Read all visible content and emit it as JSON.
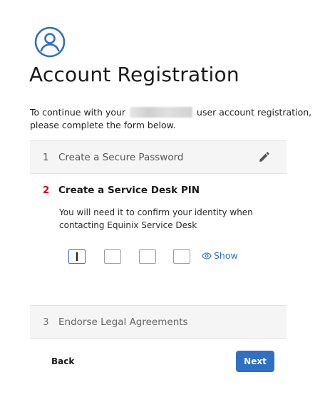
{
  "page": {
    "title": "Account Registration",
    "intro_before": "To continue with your",
    "intro_after": "user account registration,",
    "intro_line2": "please complete the form below."
  },
  "steps": [
    {
      "number": "1",
      "label": "Create a Secure Password",
      "icon": "pencil-icon"
    },
    {
      "number": "2",
      "label": "Create a Service Desk PIN",
      "help_line1": "You will need it to confirm your identity when",
      "help_line2": "contacting Equinix Service Desk"
    },
    {
      "number": "3",
      "label": "Endorse Legal Agreements"
    }
  ],
  "pin": {
    "show_label": "Show",
    "digits": [
      "",
      "",
      "",
      ""
    ]
  },
  "footer": {
    "back_label": "Back",
    "next_label": "Next"
  },
  "colors": {
    "accent": "#2f6fc4",
    "step_active_number": "#d0021b",
    "step_bg": "#f5f5f5"
  }
}
